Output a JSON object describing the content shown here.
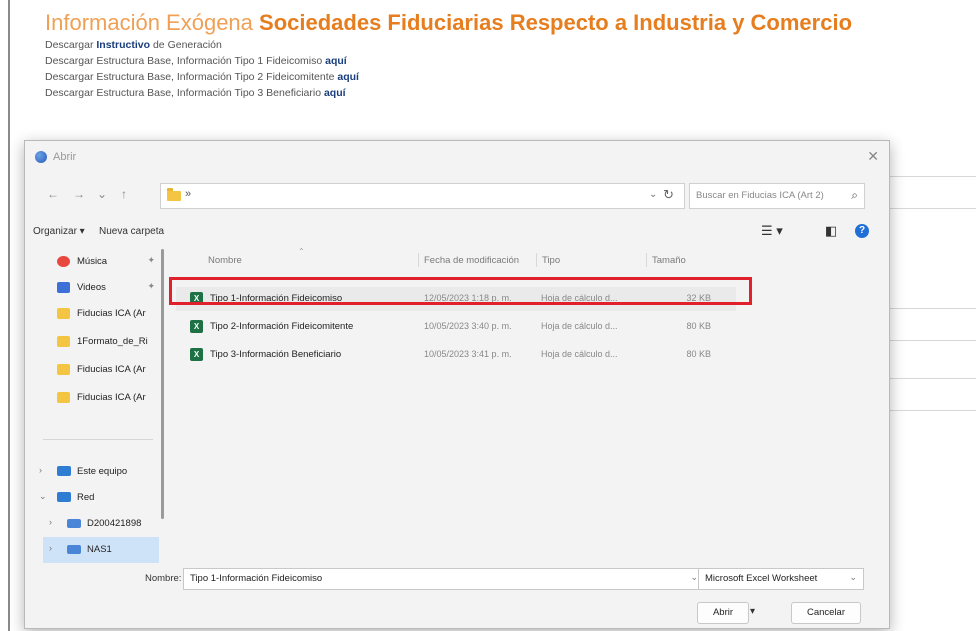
{
  "page": {
    "title_light": "Información Exógena",
    "title_bold": "Sociedades Fiduciarias Respecto a Industria y Comercio",
    "downloads": [
      {
        "prefix": "Descargar",
        "link": "Instructivo",
        "suffix": "de Generación"
      },
      {
        "prefix": "Descargar Estructura Base, Información Tipo 1 Fideicomiso",
        "link": "aquí",
        "suffix": ""
      },
      {
        "prefix": "Descargar Estructura Base, Información Tipo 2 Fideicomitente",
        "link": "aquí",
        "suffix": ""
      },
      {
        "prefix": "Descargar Estructura Base, Información Tipo 3 Beneficiario",
        "link": "aquí",
        "suffix": ""
      }
    ]
  },
  "dialog": {
    "title": "Abrir",
    "close": "✕",
    "nav": {
      "back": "←",
      "forward": "→",
      "recent": "⌄",
      "up": "↑",
      "path_chevron": "»",
      "refresh": "↻",
      "dropdown": "⌄"
    },
    "search_placeholder": "Buscar en Fiducias ICA (Art 2)",
    "search_icon": "⌕",
    "organize": "Organizar ▾",
    "new_folder": "Nueva carpeta",
    "view_icon": "☰ ▾",
    "pane_icon": "◧",
    "help_icon": "?",
    "sidebar": [
      {
        "label": "Música",
        "icon": "music",
        "pin": "📌"
      },
      {
        "label": "Videos",
        "icon": "video",
        "pin": "📌"
      },
      {
        "label": "Fiducias ICA (Ar",
        "icon": "folder"
      },
      {
        "label": "1Formato_de_Ri",
        "icon": "folder"
      },
      {
        "label": "Fiducias ICA (Ar",
        "icon": "folder"
      },
      {
        "label": "Fiducias ICA (Ar",
        "icon": "folder"
      },
      {
        "label": "Este equipo",
        "icon": "pc",
        "expand": "›"
      },
      {
        "label": "Red",
        "icon": "net",
        "expand": "⌄"
      },
      {
        "label": "D200421898",
        "icon": "drive",
        "expand": "›"
      },
      {
        "label": "NAS1",
        "icon": "drive",
        "expand": "›"
      }
    ],
    "columns": {
      "name": "Nombre",
      "date": "Fecha de modificación",
      "type": "Tipo",
      "size": "Tamaño"
    },
    "files": [
      {
        "name": "Tipo 1-Información Fideicomiso",
        "date": "12/05/2023 1:18 p. m.",
        "type": "Hoja de cálculo d...",
        "size": "32 KB"
      },
      {
        "name": "Tipo 2-Información Fideicomitente",
        "date": "10/05/2023 3:40 p. m.",
        "type": "Hoja de cálculo d...",
        "size": "80 KB"
      },
      {
        "name": "Tipo 3-Información Beneficiario",
        "date": "10/05/2023 3:41 p. m.",
        "type": "Hoja de cálculo d...",
        "size": "80 KB"
      }
    ],
    "file_icon": "X",
    "filename_label": "Nombre:",
    "filename_value": "Tipo 1-Información Fideicomiso",
    "filetype_value": "Microsoft Excel Worksheet",
    "open_button": "Abrir",
    "open_split": "▾",
    "cancel_button": "Cancelar"
  }
}
